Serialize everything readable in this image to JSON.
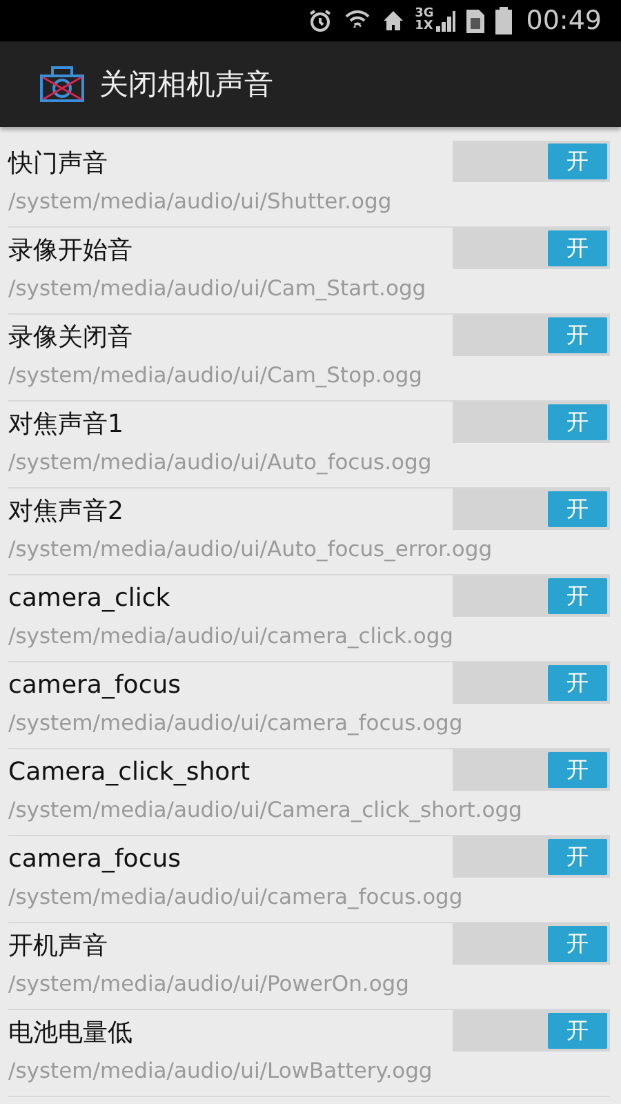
{
  "status_bar": {
    "network_top": "3G",
    "network_bottom": "1X",
    "time": "00:49"
  },
  "app_bar": {
    "title": "关闭相机声音"
  },
  "sounds": [
    {
      "name": "快门声音",
      "path": "/system/media/audio/ui/Shutter.ogg",
      "on": true,
      "toggle_label": "开"
    },
    {
      "name": "录像开始音",
      "path": "/system/media/audio/ui/Cam_Start.ogg",
      "on": true,
      "toggle_label": "开"
    },
    {
      "name": "录像关闭音",
      "path": "/system/media/audio/ui/Cam_Stop.ogg",
      "on": true,
      "toggle_label": "开"
    },
    {
      "name": "对焦声音1",
      "path": "/system/media/audio/ui/Auto_focus.ogg",
      "on": true,
      "toggle_label": "开"
    },
    {
      "name": "对焦声音2",
      "path": "/system/media/audio/ui/Auto_focus_error.ogg",
      "on": true,
      "toggle_label": "开"
    },
    {
      "name": "camera_click",
      "path": "/system/media/audio/ui/camera_click.ogg",
      "on": true,
      "toggle_label": "开"
    },
    {
      "name": "camera_focus",
      "path": "/system/media/audio/ui/camera_focus.ogg",
      "on": true,
      "toggle_label": "开"
    },
    {
      "name": "Camera_click_short",
      "path": "/system/media/audio/ui/Camera_click_short.ogg",
      "on": true,
      "toggle_label": "开"
    },
    {
      "name": "camera_focus",
      "path": "/system/media/audio/ui/camera_focus.ogg",
      "on": true,
      "toggle_label": "开"
    },
    {
      "name": "开机声音",
      "path": "/system/media/audio/ui/PowerOn.ogg",
      "on": true,
      "toggle_label": "开"
    },
    {
      "name": "电池电量低",
      "path": "/system/media/audio/ui/LowBattery.ogg",
      "on": true,
      "toggle_label": "开"
    }
  ]
}
